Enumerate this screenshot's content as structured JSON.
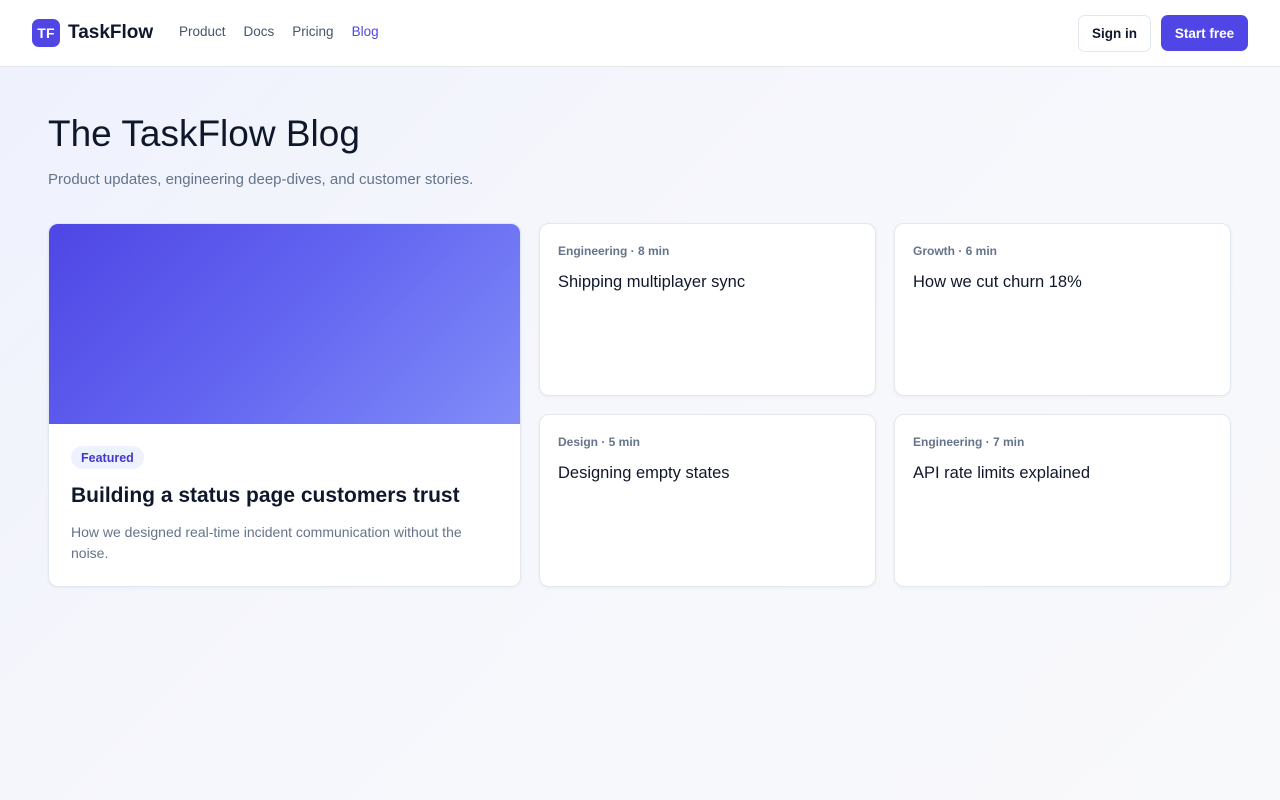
{
  "header": {
    "logo_text": "TF",
    "brand": "TaskFlow",
    "nav": [
      {
        "label": "Product"
      },
      {
        "label": "Docs"
      },
      {
        "label": "Pricing"
      },
      {
        "label": "Blog"
      }
    ],
    "active_nav": "Blog",
    "signin_label": "Sign in",
    "start_label": "Start free"
  },
  "hero": {
    "title": "The TaskFlow Blog",
    "subtitle": "Product updates, engineering deep-dives, and customer stories."
  },
  "featured": {
    "badge": "Featured",
    "title": "Building a status page customers trust",
    "description": "How we designed real-time incident communication without the noise."
  },
  "posts": [
    {
      "meta": "Engineering · 8 min",
      "title": "Shipping multiplayer sync"
    },
    {
      "meta": "Growth · 6 min",
      "title": "How we cut churn 18%"
    },
    {
      "meta": "Design · 5 min",
      "title": "Designing empty states"
    },
    {
      "meta": "Engineering · 7 min",
      "title": "API rate limits explained"
    }
  ],
  "colors": {
    "accent": "#4f46e5",
    "text": "#0f172a",
    "muted": "#64748b",
    "border": "#e2e8f0"
  }
}
